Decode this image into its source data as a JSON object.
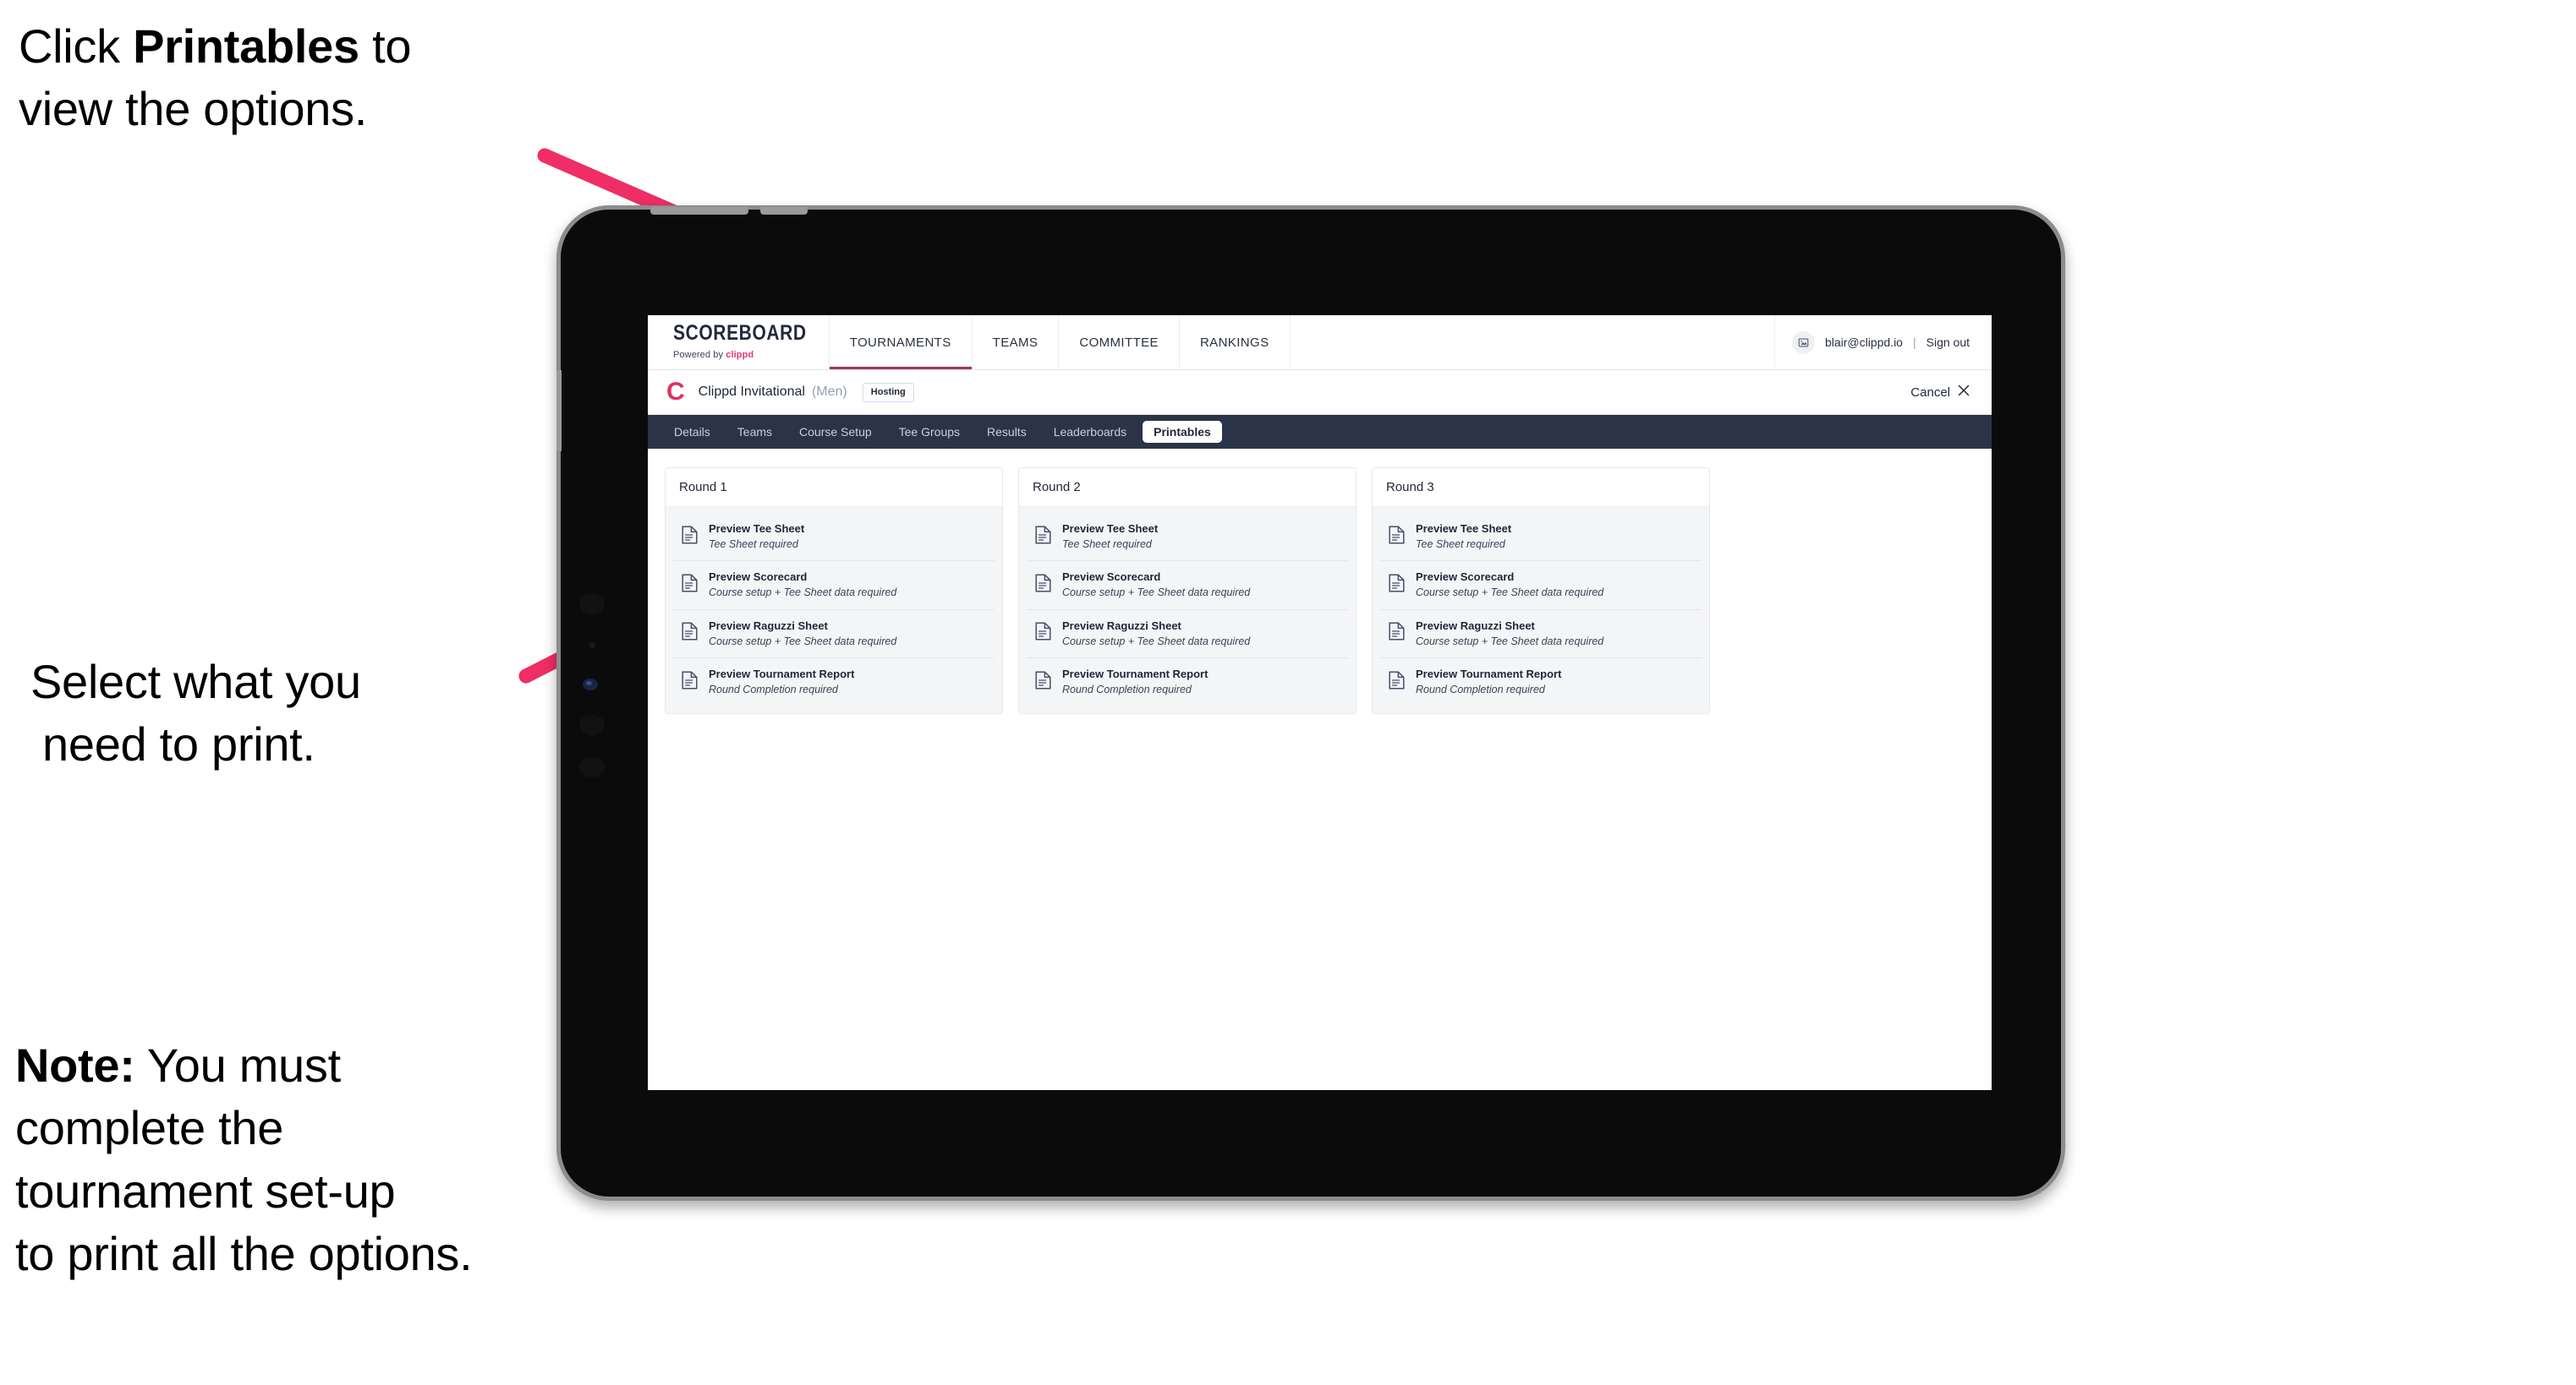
{
  "annotations": {
    "click_printables": {
      "prefix": "Click ",
      "bold": "Printables",
      "suffix": " to\nview the options."
    },
    "select_print_line1": "Select what you",
    "select_print_line2": "need to print.",
    "note": {
      "label": "Note:",
      "body": " You must\ncomplete the\ntournament set-up\nto print all the options."
    }
  },
  "device": {
    "name": "tablet"
  },
  "app": {
    "brand": {
      "title": "SCOREBOARD",
      "powered_prefix": "Powered by ",
      "powered_brand": "clippd"
    },
    "topnav": [
      {
        "label": "TOURNAMENTS",
        "active": true
      },
      {
        "label": "TEAMS",
        "active": false
      },
      {
        "label": "COMMITTEE",
        "active": false
      },
      {
        "label": "RANKINGS",
        "active": false
      }
    ],
    "user": {
      "email": "blair@clippd.io",
      "separator": "|",
      "sign_out": "Sign out"
    },
    "tournament": {
      "mark": "C",
      "name": "Clippd Invitational",
      "gender": "(Men)",
      "badge": "Hosting",
      "cancel": "Cancel"
    },
    "tabs": [
      {
        "label": "Details",
        "active": false
      },
      {
        "label": "Teams",
        "active": false
      },
      {
        "label": "Course Setup",
        "active": false
      },
      {
        "label": "Tee Groups",
        "active": false
      },
      {
        "label": "Results",
        "active": false
      },
      {
        "label": "Leaderboards",
        "active": false
      },
      {
        "label": "Printables",
        "active": true
      }
    ],
    "rounds": [
      {
        "title": "Round 1",
        "items": [
          {
            "title": "Preview Tee Sheet",
            "requirement": "Tee Sheet required"
          },
          {
            "title": "Preview Scorecard",
            "requirement": "Course setup + Tee Sheet data required"
          },
          {
            "title": "Preview Raguzzi Sheet",
            "requirement": "Course setup + Tee Sheet data required"
          },
          {
            "title": "Preview Tournament Report",
            "requirement": "Round Completion required"
          }
        ]
      },
      {
        "title": "Round 2",
        "items": [
          {
            "title": "Preview Tee Sheet",
            "requirement": "Tee Sheet required"
          },
          {
            "title": "Preview Scorecard",
            "requirement": "Course setup + Tee Sheet data required"
          },
          {
            "title": "Preview Raguzzi Sheet",
            "requirement": "Course setup + Tee Sheet data required"
          },
          {
            "title": "Preview Tournament Report",
            "requirement": "Round Completion required"
          }
        ]
      },
      {
        "title": "Round 3",
        "items": [
          {
            "title": "Preview Tee Sheet",
            "requirement": "Tee Sheet required"
          },
          {
            "title": "Preview Scorecard",
            "requirement": "Course setup + Tee Sheet data required"
          },
          {
            "title": "Preview Raguzzi Sheet",
            "requirement": "Course setup + Tee Sheet data required"
          },
          {
            "title": "Preview Tournament Report",
            "requirement": "Round Completion required"
          }
        ]
      }
    ]
  },
  "colors": {
    "accent_pink": "#ee2e64",
    "navbar": "#2b3446",
    "brand_navy": "#20293d",
    "clippd_pink": "#e8376a",
    "card_bg": "#f4f5f7"
  }
}
